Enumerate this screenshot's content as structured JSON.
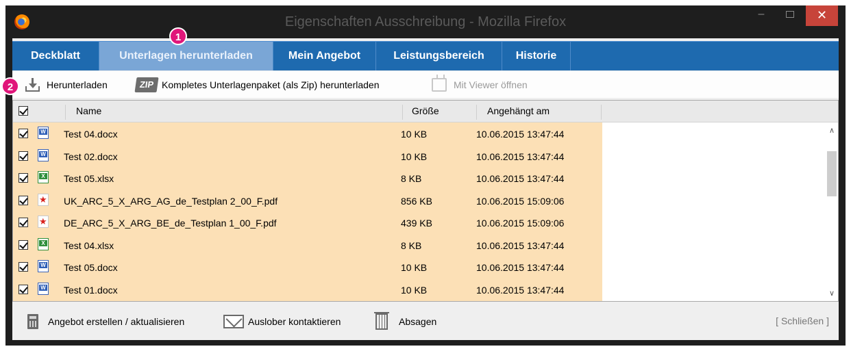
{
  "window": {
    "title": "Eigenschaften Ausschreibung - Mozilla Firefox",
    "app_icon": "firefox-icon",
    "minimize_glyph": "–",
    "close_glyph": "✕"
  },
  "tabs": [
    {
      "label": "Deckblatt",
      "active": false
    },
    {
      "label": "Unterlagen herunterladen",
      "active": true
    },
    {
      "label": "Mein Angebot",
      "active": false
    },
    {
      "label": "Leistungsbereich",
      "active": false
    },
    {
      "label": "Historie",
      "active": false
    }
  ],
  "toolbar": {
    "download_label": "Herunterladen",
    "download_icon": "download-icon",
    "zip_label": "Kompletes Unterlagenpaket (als Zip) herunterladen",
    "zip_icon_text": "ZIP",
    "viewer_label": "Mit Viewer öffnen",
    "viewer_icon": "viewer-icon",
    "viewer_disabled": true
  },
  "table": {
    "columns": [
      "Name",
      "Größe",
      "Angehängt am"
    ],
    "header_checked": true,
    "rows": [
      {
        "checked": true,
        "type": "word",
        "name": "Test 04.docx",
        "size": "10 KB",
        "attached": "10.06.2015 13:47:44"
      },
      {
        "checked": true,
        "type": "word",
        "name": "Test 02.docx",
        "size": "10 KB",
        "attached": "10.06.2015 13:47:44"
      },
      {
        "checked": true,
        "type": "excel",
        "name": "Test 05.xlsx",
        "size": "8 KB",
        "attached": "10.06.2015 13:47:44"
      },
      {
        "checked": true,
        "type": "pdf",
        "name": "UK_ARC_5_X_ARG_AG_de_Testplan 2_00_F.pdf",
        "size": "856 KB",
        "attached": "10.06.2015 15:09:06"
      },
      {
        "checked": true,
        "type": "pdf",
        "name": "DE_ARC_5_X_ARG_BE_de_Testplan 1_00_F.pdf",
        "size": "439 KB",
        "attached": "10.06.2015 15:09:06"
      },
      {
        "checked": true,
        "type": "excel",
        "name": "Test 04.xlsx",
        "size": "8 KB",
        "attached": "10.06.2015 13:47:44"
      },
      {
        "checked": true,
        "type": "word",
        "name": "Test 05.docx",
        "size": "10 KB",
        "attached": "10.06.2015 13:47:44"
      },
      {
        "checked": true,
        "type": "word",
        "name": "Test 01.docx",
        "size": "10 KB",
        "attached": "10.06.2015 13:47:44"
      }
    ],
    "row_highlight_color": "#fce0b6"
  },
  "scrollbar": {
    "up_glyph": "∧",
    "down_glyph": "∨"
  },
  "footer": {
    "create_offer_label": "Angebot erstellen / aktualisieren",
    "contact_label": "Auslober kontaktieren",
    "decline_label": "Absagen",
    "close_label": "[ Schließen ]"
  },
  "annotations": {
    "badge1": "1",
    "badge2": "2",
    "badge_color": "#e0167a"
  },
  "colors": {
    "tab_bar": "#1e6aaf",
    "tab_active": "#7aa6d6",
    "close_button": "#c7443a"
  }
}
